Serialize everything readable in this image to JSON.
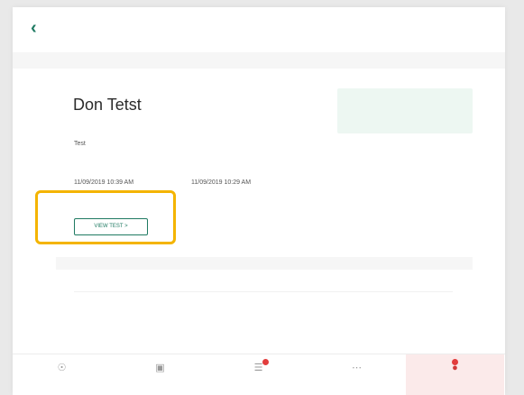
{
  "header": {
    "title": "",
    "back_icon": "chevron-left-icon"
  },
  "record": {
    "record_label": "",
    "name": "Don Tetst",
    "field1_label": "",
    "field1_value": "Test",
    "date1_label": "",
    "date1_value": "11/09/2019  10:39 AM",
    "date2_label": "",
    "date2_value": "11/09/2019  10:29 AM",
    "status_text": "",
    "status_sub": "",
    "view_button": "VIEW TEST >"
  },
  "veteran": {
    "title": "",
    "name_label": "",
    "name_value": "",
    "id_label": "",
    "id_value": "",
    "dob_label": "",
    "dob_value": "",
    "type_label": "",
    "type_value": ""
  },
  "bottom_nav": {
    "items": [
      {
        "label": "",
        "icon": "home-icon"
      },
      {
        "label": "",
        "icon": "briefcase-icon"
      },
      {
        "label": "",
        "icon": "clipboard-icon"
      },
      {
        "label": "",
        "icon": "bell-icon"
      },
      {
        "label": "",
        "icon": "alert-icon"
      }
    ]
  },
  "colors": {
    "accent": "#1f7a62",
    "status_bg": "#edf7f2",
    "highlight": "#f4b400",
    "badge": "#e23d3d"
  }
}
